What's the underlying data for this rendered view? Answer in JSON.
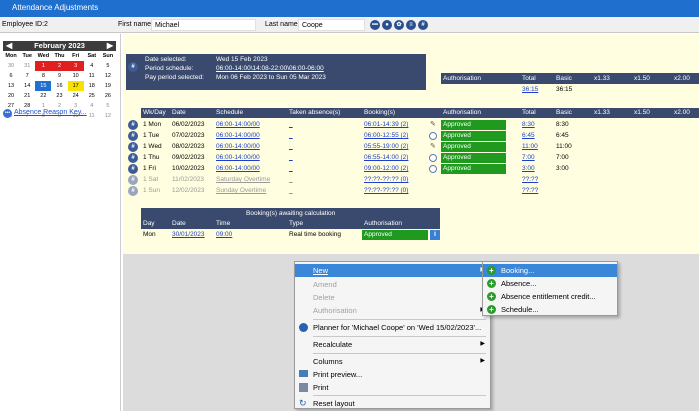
{
  "window": {
    "title": "Attendance Adjustments"
  },
  "topbar": {
    "employee_label": "Employee ID:",
    "employee_id": "2",
    "first_label": "First name:",
    "first_name": "Michael",
    "last_label": "Last name:",
    "last_name": "Coope"
  },
  "calendar": {
    "month": "February 2023",
    "dows": [
      "Mon",
      "Tue",
      "Wed",
      "Thu",
      "Fri",
      "Sat",
      "Sun"
    ],
    "weeks": [
      [
        "30",
        "31",
        "1",
        "2",
        "3",
        "4",
        "5"
      ],
      [
        "6",
        "7",
        "8",
        "9",
        "10",
        "11",
        "12"
      ],
      [
        "13",
        "14",
        "15",
        "16",
        "17",
        "18",
        "19"
      ],
      [
        "20",
        "21",
        "22",
        "23",
        "24",
        "25",
        "26"
      ],
      [
        "27",
        "28",
        "1",
        "2",
        "3",
        "4",
        "5"
      ],
      [
        "6",
        "7",
        "8",
        "9",
        "10",
        "11",
        "12"
      ]
    ]
  },
  "absence_link": "Absence Reason Key...",
  "summary": {
    "date_selected_label": "Date selected:",
    "date_selected": "Wed 15 Feb 2023",
    "period_label": "Period schedule:",
    "period": "06:00-14:00\\14:08-22:00\\06:00-06:00",
    "pay_label": "Pay period selected:",
    "pay": "Mon 06 Feb 2023 to Sun 05 Mar 2023"
  },
  "totals_header": {
    "authorisation": "Authorisation",
    "total": "Total",
    "basic": "Basic",
    "x133": "x1.33",
    "x150": "x1.50",
    "x200": "x2.00"
  },
  "totals": {
    "total": "36:15",
    "basic": "36:15"
  },
  "table_header": {
    "wkday": "Wk/Day",
    "date": "Date",
    "schedule": "Schedule",
    "taken": "Taken absence(s)",
    "bookings": "Booking(s)",
    "authorisation": "Authorisation",
    "total": "Total",
    "basic": "Basic",
    "x133": "x1.33",
    "x150": "x1.50",
    "x200": "x2.00"
  },
  "rows": [
    {
      "day": "1 Mon",
      "date": "06/02/2023",
      "schedule": "06:00-14:00/00",
      "taken": "_",
      "booking": "06:01-14:39 (2)",
      "auth": "Approved",
      "total": "8:30",
      "basic": "8:30"
    },
    {
      "day": "1 Tue",
      "date": "07/02/2023",
      "schedule": "06:00-14:00/00",
      "taken": "_",
      "booking": "06:00-12:55 (2)",
      "auth": "Approved",
      "total": "6:45",
      "basic": "6:45"
    },
    {
      "day": "1 Wed",
      "date": "08/02/2023",
      "schedule": "06:00-14:00/00",
      "taken": "_",
      "booking": "05:55-19:00 (2)",
      "auth": "Approved",
      "total": "11:00",
      "basic": "11:00"
    },
    {
      "day": "1 Thu",
      "date": "09/02/2023",
      "schedule": "06:00-14:00/00",
      "taken": "_",
      "booking": "06:55-14:00 (2)",
      "auth": "Approved",
      "total": "7:00",
      "basic": "7:00"
    },
    {
      "day": "1 Fri",
      "date": "10/02/2023",
      "schedule": "06:00-14:00/00",
      "taken": "_",
      "booking": "09:00-12:00 (2)",
      "auth": "Approved",
      "total": "3:00",
      "basic": "3:00"
    },
    {
      "day": "1 Sat",
      "date": "11/02/2023",
      "schedule": "Saturday Overtime",
      "taken": "_",
      "booking": "??:??-??:?? (0)",
      "auth": "",
      "total": "??:??",
      "basic": ""
    },
    {
      "day": "1 Sun",
      "date": "12/02/2023",
      "schedule": "Sunday Overtime",
      "taken": "_",
      "booking": "??:??-??:?? (0)",
      "auth": "",
      "total": "??:??",
      "basic": ""
    }
  ],
  "awaiting": {
    "title": "Booking(s) awaiting calculation",
    "h_day": "Day",
    "h_date": "Date",
    "h_time": "Time",
    "h_type": "Type",
    "h_auth": "Authorisation",
    "day": "Mon",
    "date": "30/01/2023",
    "time": "09:00",
    "type": "Real time booking",
    "auth": "Approved"
  },
  "context_menu": {
    "new": "New",
    "amend": "Amend",
    "delete": "Delete",
    "authorisation": "Authorisation",
    "planner": "Planner for 'Michael Coope' on 'Wed 15/02/2023'...",
    "recalculate": "Recalculate",
    "columns": "Columns",
    "print_preview": "Print preview...",
    "print": "Print",
    "reset": "Reset layout"
  },
  "submenu": {
    "booking": "Booking...",
    "absence": "Absence...",
    "entitlement": "Absence entitlement credit...",
    "schedule": "Schedule..."
  }
}
